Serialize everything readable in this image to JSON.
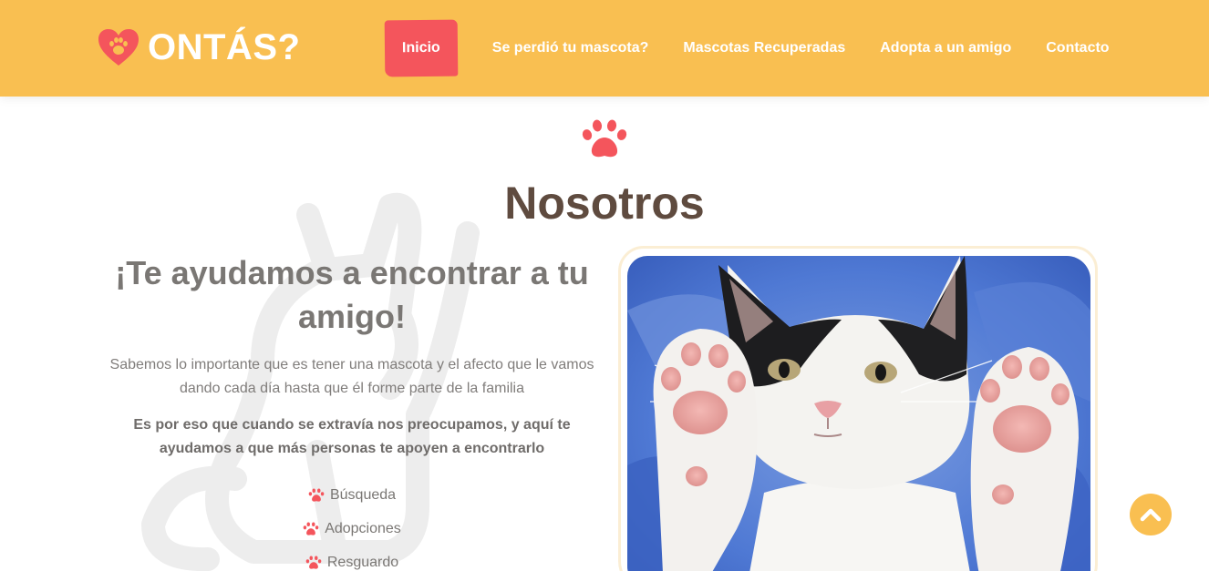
{
  "header": {
    "brand_name": "ONTÁS?",
    "nav": [
      {
        "label": "Inicio",
        "active": true
      },
      {
        "label": "Se perdió tu mascota?",
        "active": false
      },
      {
        "label": "Mascotas Recuperadas",
        "active": false
      },
      {
        "label": "Adopta a un amigo",
        "active": false
      },
      {
        "label": "Contacto",
        "active": false
      }
    ]
  },
  "about": {
    "section_title": "Nosotros",
    "heading": "¡Te ayudamos a encontrar a tu amigo!",
    "paragraph_1": "Sabemos lo importante que es tener una mascota y el afecto que le vamos dando cada día hasta que él forme parte de la familia",
    "paragraph_2": "Es por eso que cuando se extravía nos preocupamos, y aquí te ayudamos a que más personas te apoyen a encontrarlo",
    "features": [
      "Búsqueda",
      "Adopciones",
      "Resguardo"
    ],
    "photo_icon": "kitten-photo"
  },
  "icons": {
    "logo": "heart-paw-icon",
    "section": "paw-icon",
    "feature": "paw-icon",
    "back_to_top": "chevron-up-icon",
    "background": "cat-outline"
  },
  "colors": {
    "header_bg": "#f9bf51",
    "accent": "#f4555c",
    "title": "#5f4b3f",
    "text": "#7a7774"
  }
}
